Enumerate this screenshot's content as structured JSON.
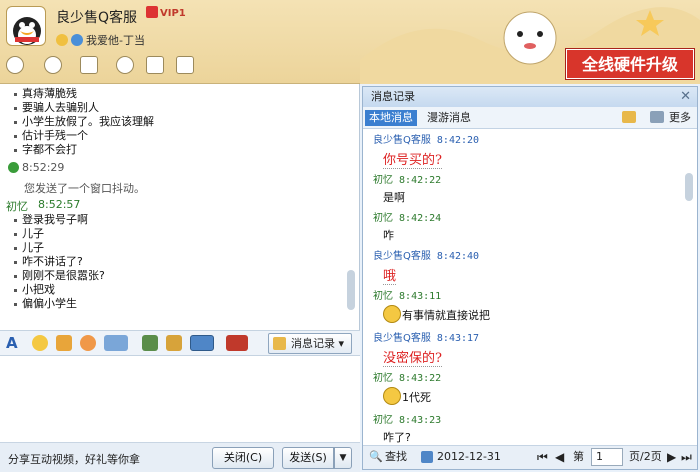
{
  "header": {
    "title": "良少售Q客服",
    "vip": "VIP1",
    "signature": "我爱他-丁当",
    "banner": "全线硬件升级"
  },
  "chat": {
    "lines_top": [
      "真痔薄脆残",
      "要骗人去骗别人",
      "小学生放假了。我应该理解",
      "估计手残一个",
      "字都不会打"
    ],
    "time1": "8:52:29",
    "system_msg": "您发送了一个窗口抖动。",
    "sender2": "初忆",
    "time2": "8:52:57",
    "lines_bottom": [
      "登录我号子啊",
      "儿子",
      "儿子",
      "咋不讲话了?",
      "刚刚不是很嚣张?",
      "小把戏",
      "偏偏小学生"
    ]
  },
  "format_bar": {
    "msg_record_label": "消息记录"
  },
  "bottom": {
    "promo": "分享互动视频，好礼等你拿",
    "close_label": "关闭(C)",
    "send_label": "发送(S)"
  },
  "panel": {
    "title": "消息记录",
    "tab_local": "本地消息",
    "tab_roam": "漫游消息",
    "more": "更多",
    "records": [
      {
        "name": "良少售Q客服",
        "time": "8:42:20",
        "text": "你号买的?",
        "style": "hand",
        "who": "blue"
      },
      {
        "name": "初忆",
        "time": "8:42:22",
        "text": "是啊",
        "style": "plain",
        "who": "green"
      },
      {
        "name": "初忆",
        "time": "8:42:24",
        "text": "咋",
        "style": "plain",
        "who": "green"
      },
      {
        "name": "良少售Q客服",
        "time": "8:42:40",
        "text": "哦",
        "style": "hand",
        "who": "blue"
      },
      {
        "name": "初忆",
        "time": "8:43:11",
        "text": "有事情就直接说把",
        "style": "face",
        "who": "green"
      },
      {
        "name": "良少售Q客服",
        "time": "8:43:17",
        "text": "没密保的?",
        "style": "hand",
        "who": "blue"
      },
      {
        "name": "初忆",
        "time": "8:43:22",
        "text": "1代死",
        "style": "face",
        "who": "green"
      },
      {
        "name": "初忆",
        "time": "8:43:23",
        "text": "咋了?",
        "style": "plain",
        "who": "green"
      }
    ],
    "footer": {
      "search": "查找",
      "date": "2012-12-31",
      "page_prefix": "第",
      "page_value": "1",
      "page_suffix": "页/2页"
    }
  },
  "colors": {
    "accent": "#3b7fd0",
    "banner": "#d8352b",
    "green_name": "#2d7a2d",
    "blue_name": "#2a5fb0"
  }
}
